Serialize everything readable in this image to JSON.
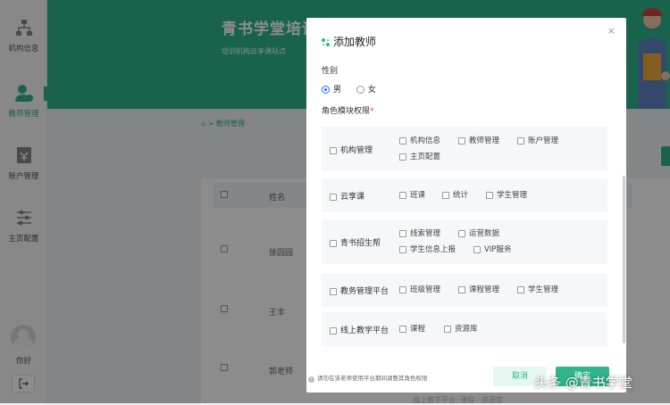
{
  "sidebar": {
    "items": [
      {
        "label": "机构信息",
        "icon": "org-chart-icon"
      },
      {
        "label": "教师管理",
        "icon": "teacher-icon"
      },
      {
        "label": "账户管理",
        "icon": "account-icon"
      },
      {
        "label": "主页配置",
        "icon": "settings-sliders-icon"
      }
    ],
    "active_index": 1,
    "greeting": "你好",
    "logout_icon": "logout-icon"
  },
  "banner": {
    "title": "青书学堂培训",
    "subtitle": "培训机构云享课站点"
  },
  "breadcrumb": "⌂ > 教师管理",
  "table": {
    "header_name": "姓名",
    "rows": [
      "徐园园",
      "王丰",
      "郭老师"
    ],
    "bottom_text": "线上教学平台: 课程 · 资源库"
  },
  "modal": {
    "title": "添加教师",
    "close": "×",
    "gender_label": "性别",
    "gender_options": [
      "男",
      "女"
    ],
    "gender_selected": "男",
    "roles_label": "角色模块权限",
    "required_mark": "*",
    "roles": [
      {
        "name": "机构管理",
        "options": [
          "机构信息",
          "教师管理",
          "账户管理",
          "主页配置"
        ]
      },
      {
        "name": "云享课",
        "options": [
          "班课",
          "统计",
          "学生管理"
        ]
      },
      {
        "name": "青书招生帮",
        "options": [
          "线索管理",
          "运营数据",
          "学生信息上报",
          "VIP服务"
        ]
      },
      {
        "name": "教务管理平台",
        "options": [
          "班级管理",
          "课程管理",
          "学生管理"
        ]
      },
      {
        "name": "线上教学平台",
        "options": [
          "课程",
          "资源库"
        ]
      }
    ],
    "footer_note": "请勿在该老师使用平台期间调整其角色权限",
    "cancel_label": "取消",
    "ok_label": "确定"
  },
  "watermark": "头条 @青书学堂",
  "colors": {
    "accent": "#2fb58b",
    "radio": "#1677ff"
  }
}
